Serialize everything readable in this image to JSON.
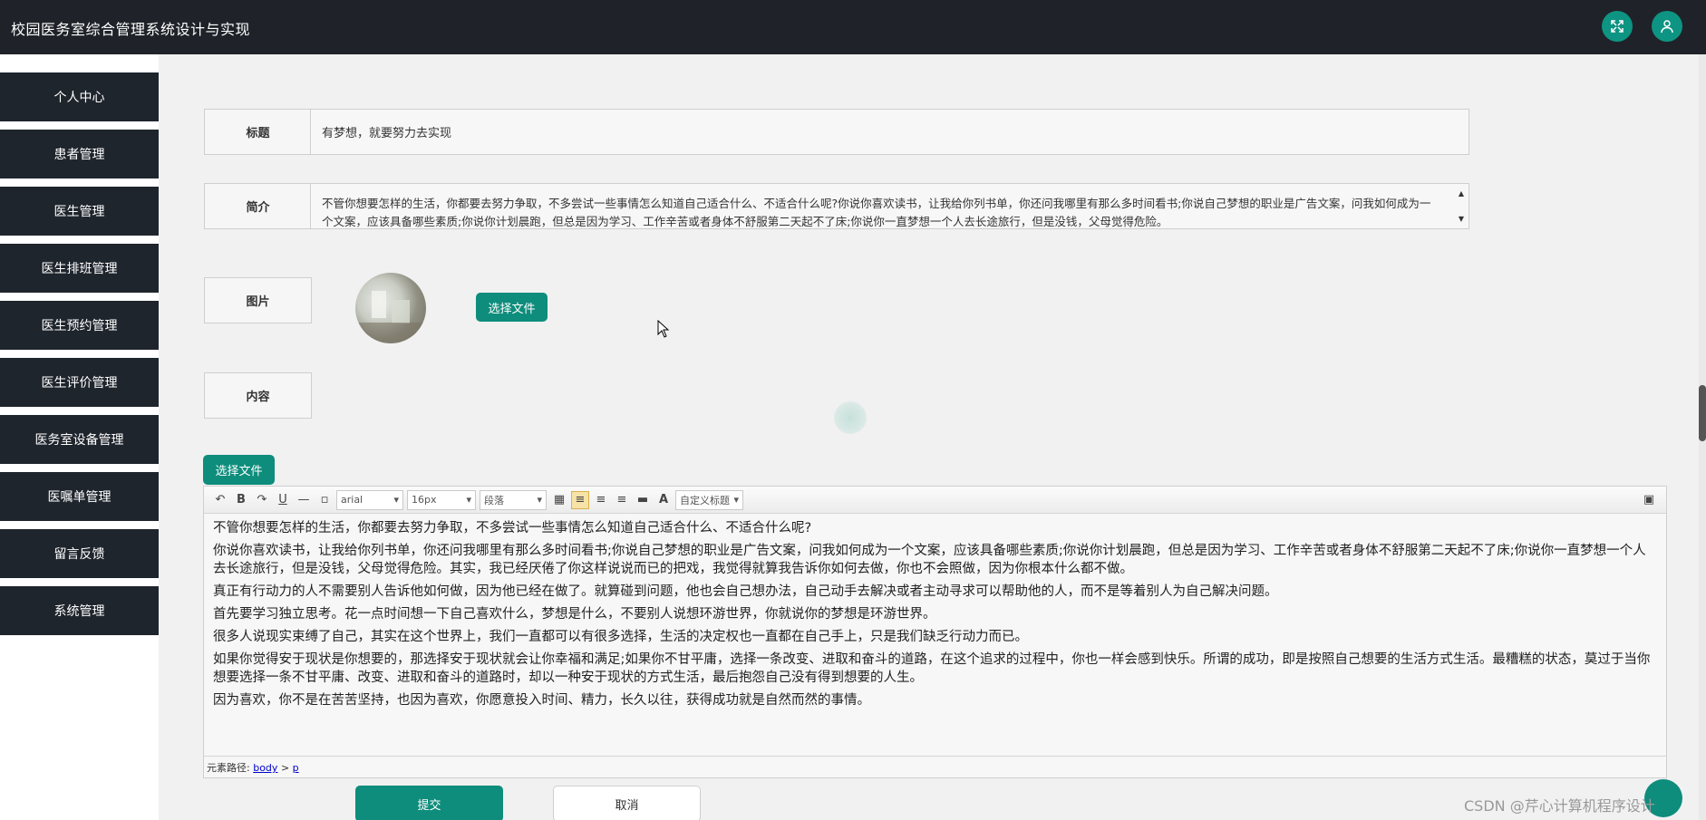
{
  "app": {
    "title": "校园医务室综合管理系统设计与实现"
  },
  "header": {
    "fullscreen_icon": "fullscreen-icon",
    "user_icon": "user-icon"
  },
  "sidebar": {
    "items": [
      {
        "label": "个人中心"
      },
      {
        "label": "患者管理"
      },
      {
        "label": "医生管理"
      },
      {
        "label": "医生排班管理"
      },
      {
        "label": "医生预约管理"
      },
      {
        "label": "医生评价管理"
      },
      {
        "label": "医务室设备管理"
      },
      {
        "label": "医嘱单管理"
      },
      {
        "label": "留言反馈"
      },
      {
        "label": "系统管理"
      }
    ]
  },
  "form": {
    "title_label": "标题",
    "title_value": "有梦想，就要努力去实现",
    "summary_label": "简介",
    "summary_value": "不管你想要怎样的生活，你都要去努力争取，不多尝试一些事情怎么知道自己适合什么、不适合什么呢?你说你喜欢读书，让我给你列书单，你还问我哪里有那么多时间看书;你说自己梦想的职业是广告文案，问我如何成为一个文案，应该具备哪些素质;你说你计划晨跑，但总是因为学习、工作辛苦或者身体不舒服第二天起不了床;你说你一直梦想一个人去长途旅行，但是没钱，父母觉得危险。",
    "image_label": "图片",
    "choose_file_label": "选择文件",
    "content_label": "内容",
    "content_choose_file_label": "选择文件"
  },
  "editor": {
    "font_family": "arial",
    "font_size": "16px",
    "paragraph": "段落",
    "custom_title": "自定义标题",
    "paragraphs": [
      "不管你想要怎样的生活，你都要去努力争取，不多尝试一些事情怎么知道自己适合什么、不适合什么呢?",
      "你说你喜欢读书，让我给你列书单，你还问我哪里有那么多时间看书;你说自己梦想的职业是广告文案，问我如何成为一个文案，应该具备哪些素质;你说你计划晨跑，但总是因为学习、工作辛苦或者身体不舒服第二天起不了床;你说你一直梦想一个人去长途旅行，但是没钱，父母觉得危险。其实，我已经厌倦了你这样说说而已的把戏，我觉得就算我告诉你如何去做，你也不会照做，因为你根本什么都不做。",
      "真正有行动力的人不需要别人告诉他如何做，因为他已经在做了。就算碰到问题，他也会自己想办法，自己动手去解决或者主动寻求可以帮助他的人，而不是等着别人为自己解决问题。",
      "首先要学习独立思考。花一点时间想一下自己喜欢什么，梦想是什么，不要别人说想环游世界，你就说你的梦想是环游世界。",
      "很多人说现实束缚了自己，其实在这个世界上，我们一直都可以有很多选择，生活的决定权也一直都在自己手上，只是我们缺乏行动力而已。",
      "如果你觉得安于现状是你想要的，那选择安于现状就会让你幸福和满足;如果你不甘平庸，选择一条改变、进取和奋斗的道路，在这个追求的过程中，你也一样会感到快乐。所谓的成功，即是按照自己想要的生活方式生活。最糟糕的状态，莫过于当你想要选择一条不甘平庸、改变、进取和奋斗的道路时，却以一种安于现状的方式生活，最后抱怨自己没有得到想要的人生。",
      "因为喜欢，你不是在苦苦坚持，也因为喜欢，你愿意投入时间、精力，长久以往，获得成功就是自然而然的事情。"
    ],
    "status_prefix": "元素路径:",
    "status_body": "body",
    "status_sep": ">",
    "status_p": "p"
  },
  "actions": {
    "submit_label": "提交",
    "cancel_label": "取消"
  },
  "watermark": "CSDN @芹心计算机程序设计",
  "colors": {
    "accent": "#0e8d7c",
    "topbar": "#1f2329",
    "sidebar_item": "#1f252d"
  }
}
